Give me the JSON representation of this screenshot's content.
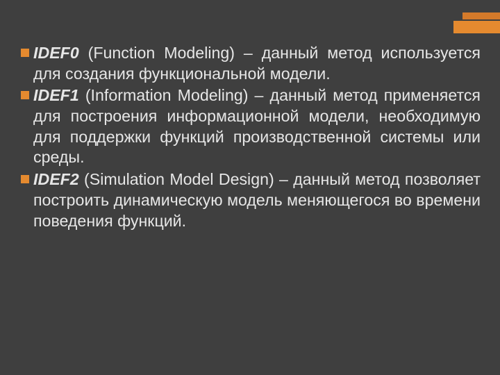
{
  "accent_color": "#e58a2f",
  "bullets": [
    {
      "term": "IDEF0",
      "subtitle": " (Function Modeling) – данный метод используется для создания функциональной модели."
    },
    {
      "term": "IDEF1",
      "subtitle": " (Information Modeling) – данный метод применяется для построения информационной модели, необходимую для поддержки функций производственной системы или среды."
    },
    {
      "term": "IDEF2",
      "subtitle": " (Simulation Model Design) – данный метод позволяет построить динамическую модель меняющегося во времени поведения функций."
    }
  ]
}
